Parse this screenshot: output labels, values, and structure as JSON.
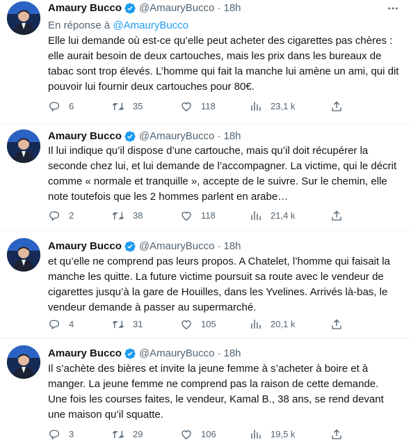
{
  "colors": {
    "accent": "#1d9bf0",
    "text": "#0f1419",
    "secondary": "#536471",
    "divider": "#eff3f4"
  },
  "tweets": [
    {
      "name": "Amaury Bucco",
      "handle": "@AmauryBucco",
      "separator": "·",
      "time": "18h",
      "reply_prefix": "En réponse à ",
      "reply_mention": "@AmauryBucco",
      "text": "Elle lui demande où est-ce qu’elle peut acheter des cigarettes pas chères : elle aurait besoin de deux cartouches, mais les prix dans les bureaux de tabac sont trop élevés. L’homme qui fait la manche lui amène un ami, qui dit pouvoir lui fournir deux cartouches pour 80€.",
      "replies": "6",
      "retweets": "35",
      "likes": "118",
      "views": "23,1 k"
    },
    {
      "name": "Amaury Bucco",
      "handle": "@AmauryBucco",
      "separator": "·",
      "time": "18h",
      "text": "Il lui indique qu’il dispose d’une cartouche, mais qu’il doit récupérer la seconde chez lui, et lui demande de l’accompagner. La victime, qui le décrit comme « normale et tranquille », accepte de le suivre. Sur le chemin, elle note toutefois que les 2 hommes parlent  en arabe…",
      "replies": "2",
      "retweets": "38",
      "likes": "118",
      "views": "21,4 k"
    },
    {
      "name": "Amaury Bucco",
      "handle": "@AmauryBucco",
      "separator": "·",
      "time": "18h",
      "text": "et qu’elle ne comprend pas leurs propos. A Chatelet, l’homme qui faisait la manche les quitte. La future victime poursuit sa route avec le vendeur de cigarettes jusqu’à la gare de Houilles, dans les Yvelines. Arrivés là-bas, le vendeur demande à passer au supermarché.",
      "replies": "4",
      "retweets": "31",
      "likes": "105",
      "views": "20,1 k"
    },
    {
      "name": "Amaury Bucco",
      "handle": "@AmauryBucco",
      "separator": "·",
      "time": "18h",
      "text": "Il s’achète des bières et invite la jeune femme à s’acheter à boire et à manger. La jeune femme ne comprend pas la raison de cette demande. Une fois les courses faites, le vendeur, Kamal B., 38 ans, se rend devant une maison qu’il squatte.",
      "replies": "3",
      "retweets": "29",
      "likes": "106",
      "views": "19,5 k"
    }
  ]
}
